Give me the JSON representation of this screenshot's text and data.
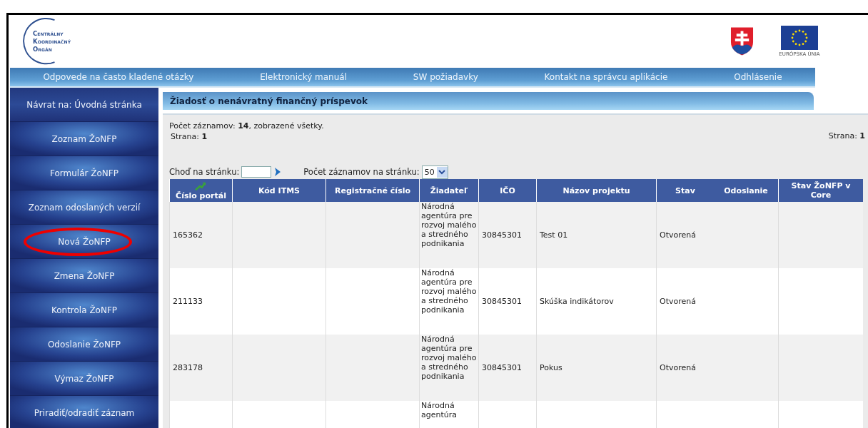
{
  "header": {
    "logo_lines": [
      "Centrálny",
      "Koordinačný",
      "Orgán"
    ],
    "eu_caption": "EURÓPSKA ÚNIA"
  },
  "nav": [
    "Odpovede na často kladené otázky",
    "Elektronický manuál",
    "SW požiadavky",
    "Kontakt na správcu aplikácie",
    "Odhlásenie"
  ],
  "sidebar": {
    "back": "Návrat na: Úvodná stránka",
    "items": [
      {
        "label": "Zoznam ŽoNFP",
        "highlighted": false
      },
      {
        "label": "Formulár ŽoNFP",
        "highlighted": false
      },
      {
        "label": "Zoznam odoslaných verzií",
        "highlighted": false
      },
      {
        "label": "Nová ŽoNFP",
        "highlighted": true
      },
      {
        "label": "Zmena ŽoNFP",
        "highlighted": false
      },
      {
        "label": "Kontrola ŽoNFP",
        "highlighted": false
      },
      {
        "label": "Odoslanie ŽoNFP",
        "highlighted": false
      },
      {
        "label": "Výmaz ŽoNFP",
        "highlighted": false
      },
      {
        "label": "Priradiť/odradiť záznam",
        "highlighted": false
      }
    ]
  },
  "panel": {
    "title": "Žiadosť o nenávratný finančný príspevok",
    "summary": "Počet záznamov: **14**, zobrazené všetky.",
    "page_left": "Strana: **1**",
    "page_right": "Strana: **1**",
    "goto_label": "Choď na stránku:",
    "per_page_label": "Počet záznamov na stránku:",
    "per_page_value": "50",
    "table": {
      "columns": [
        "Číslo portál",
        "Kód ITMS",
        "Registračné číslo",
        "Žiadateľ",
        "IČO",
        "Názov projektu",
        "Stav",
        "Odoslanie",
        "Stav ŽoNFP v Core"
      ],
      "rows": [
        [
          "165362",
          "",
          "",
          "Národná agentúra pre rozvoj malého a stredného podnikania",
          "30845301",
          "Test 01",
          "Otvorená",
          "",
          ""
        ],
        [
          "211133",
          "",
          "",
          "Národná agentúra pre rozvoj malého a stredného podnikania",
          "30845301",
          "Skúška indikátorov",
          "Otvorená",
          "",
          ""
        ],
        [
          "283178",
          "",
          "",
          "Národná agentúra pre rozvoj malého a stredného podnikania",
          "30845301",
          "Pokus",
          "Otvorená",
          "",
          ""
        ],
        [
          "",
          "",
          "",
          "Národná agentúra",
          "",
          "",
          "",
          "",
          ""
        ]
      ]
    }
  }
}
